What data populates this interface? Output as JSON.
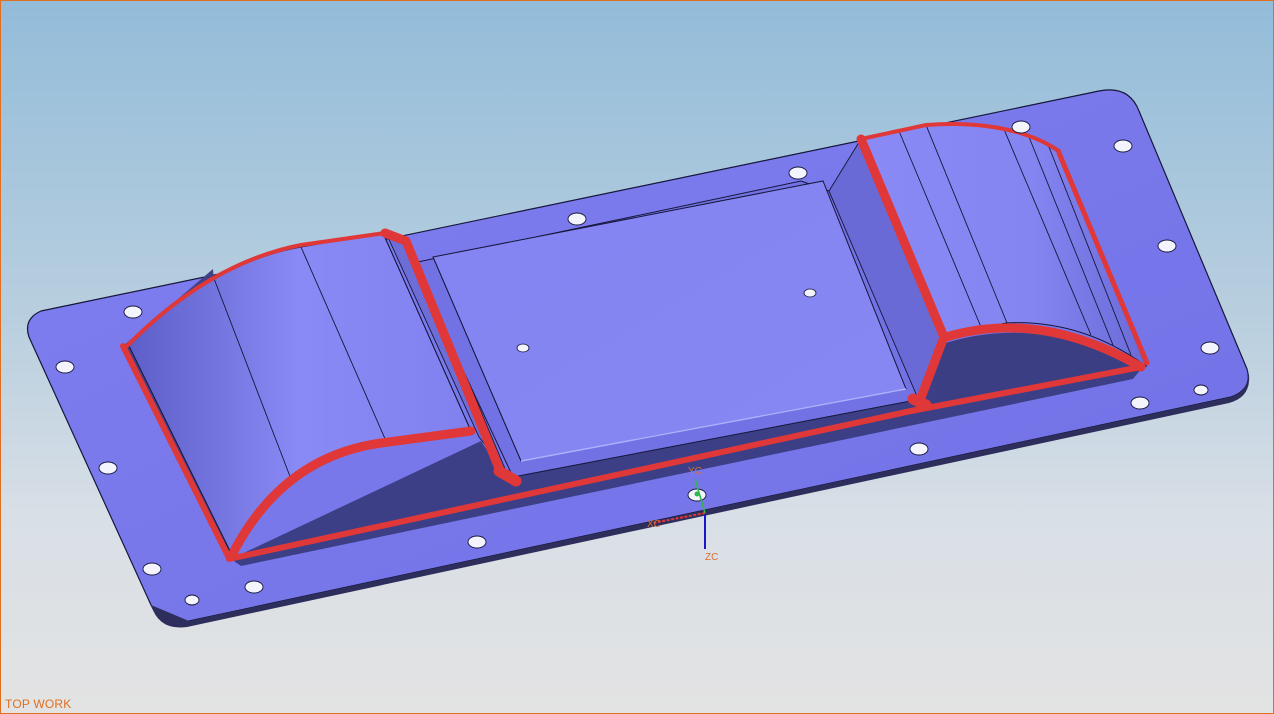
{
  "view": {
    "label": "TOP WORK"
  },
  "triad": {
    "y_label": "YC",
    "x_label": "XC",
    "z_label": "ZC"
  },
  "colors": {
    "part_face": "#8585f2",
    "part_shade": "#6b6bd8",
    "part_dark": "#3d3f86",
    "fillet": "#e03838",
    "edge": "#16163a",
    "accent": "#e07020",
    "background_top": "#93bcd9",
    "background_bottom": "#e3e3e3"
  },
  "icons": {
    "triad": "wcs-triad-icon"
  }
}
